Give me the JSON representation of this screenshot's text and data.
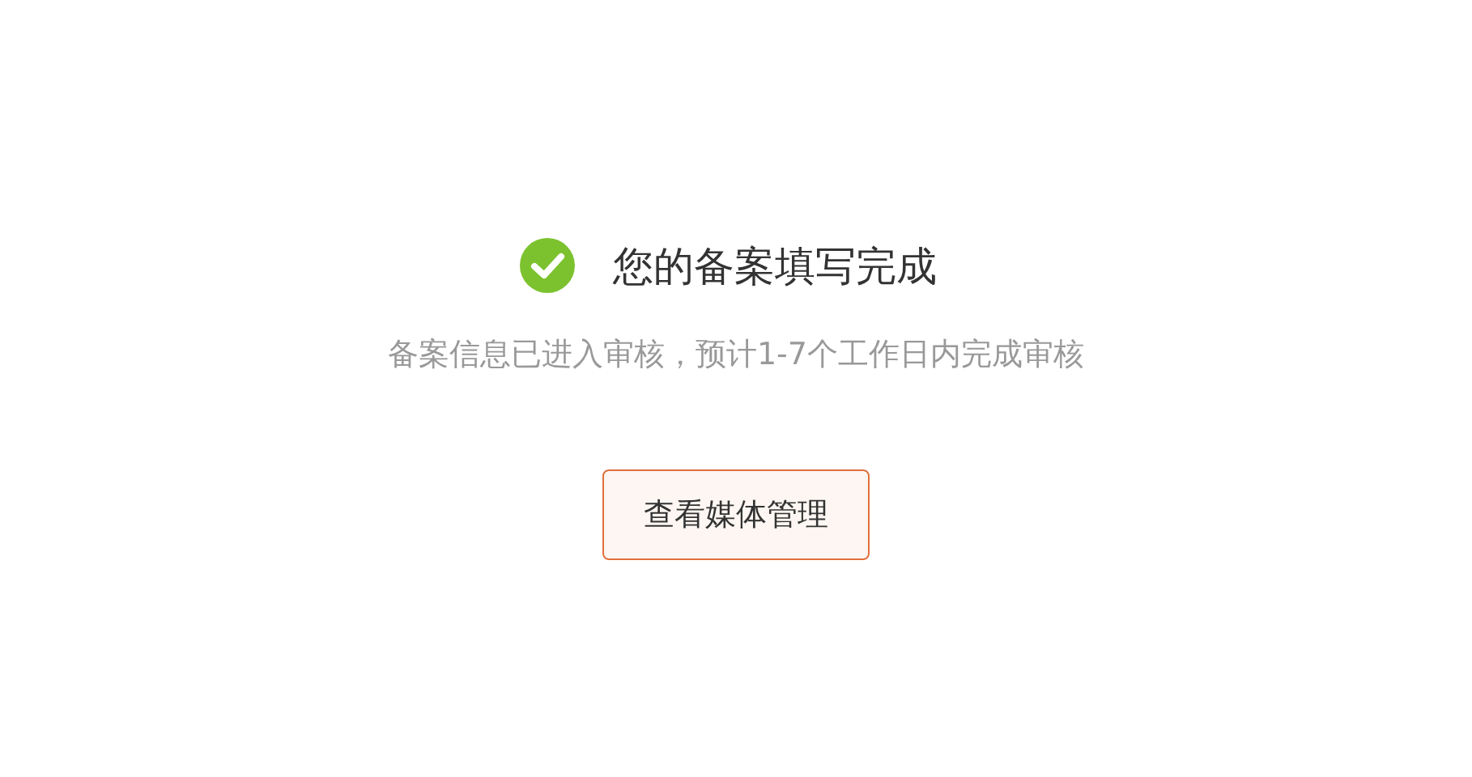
{
  "result": {
    "title": "您的备案填写完成",
    "message": "备案信息已进入审核，预计1-7个工作日内完成审核"
  },
  "button": {
    "label": "查看媒体管理"
  }
}
